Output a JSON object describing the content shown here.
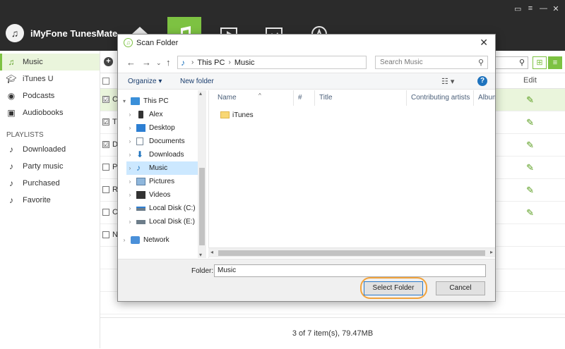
{
  "app": {
    "name": "iMyFone TunesMate"
  },
  "colors": {
    "accent": "#7dc242",
    "topbar": "#2b2b2b",
    "selection": "#cce8ff",
    "highlight_ring": "#f2a33c"
  },
  "nav_tabs": [
    {
      "icon": "home-icon"
    },
    {
      "icon": "music-icon"
    },
    {
      "icon": "video-icon"
    },
    {
      "icon": "photo-icon"
    },
    {
      "icon": "apps-icon"
    }
  ],
  "sidebar": {
    "items": [
      {
        "label": "Music",
        "icon": "music-note-icon"
      },
      {
        "label": "iTunes U",
        "icon": "graduation-cap-icon"
      },
      {
        "label": "Podcasts",
        "icon": "podcast-icon"
      },
      {
        "label": "Audiobooks",
        "icon": "audiobook-icon"
      }
    ],
    "playlists_heading": "PLAYLISTS",
    "playlists": [
      {
        "label": "Downloaded"
      },
      {
        "label": "Party music"
      },
      {
        "label": "Purchased"
      },
      {
        "label": "Favorite"
      }
    ]
  },
  "main": {
    "edit_header": "Edit",
    "rows": [
      {
        "letter": "C",
        "checked": "☑"
      },
      {
        "letter": "T",
        "checked": "☑"
      },
      {
        "letter": "D",
        "checked": "☑"
      },
      {
        "letter": "Pa",
        "checked": ""
      },
      {
        "letter": "R",
        "checked": ""
      },
      {
        "letter": "C",
        "checked": ""
      },
      {
        "letter": "N",
        "checked": ""
      }
    ],
    "status": "3 of 7 item(s), 79.47MB"
  },
  "dialog": {
    "title": "Scan Folder",
    "address": [
      "This PC",
      "Music"
    ],
    "search_placeholder": "Search Music",
    "organize_label": "Organize ▾",
    "new_folder_label": "New folder",
    "tree": [
      {
        "label": "This PC",
        "arrow": "▾",
        "icon": "computer-icon"
      },
      {
        "label": "Alex",
        "arrow": "›",
        "icon": "phone-icon"
      },
      {
        "label": "Desktop",
        "arrow": "›",
        "icon": "desktop-icon"
      },
      {
        "label": "Documents",
        "arrow": "›",
        "icon": "documents-icon"
      },
      {
        "label": "Downloads",
        "arrow": "›",
        "icon": "downloads-icon"
      },
      {
        "label": "Music",
        "arrow": "›",
        "icon": "music-folder-icon"
      },
      {
        "label": "Pictures",
        "arrow": "›",
        "icon": "pictures-icon"
      },
      {
        "label": "Videos",
        "arrow": "›",
        "icon": "videos-icon"
      },
      {
        "label": "Local Disk (C:)",
        "arrow": "›",
        "icon": "disk-icon"
      },
      {
        "label": "Local Disk (E:)",
        "arrow": "›",
        "icon": "disk-icon"
      },
      {
        "label": "Network",
        "arrow": "›",
        "icon": "network-icon"
      }
    ],
    "columns": [
      "Name",
      "#",
      "Title",
      "Contributing artists",
      "Album"
    ],
    "files": [
      {
        "name": "iTunes",
        "icon": "folder-icon"
      }
    ],
    "folder_label": "Folder:",
    "folder_value": "Music",
    "select_label": "Select Folder",
    "cancel_label": "Cancel"
  }
}
